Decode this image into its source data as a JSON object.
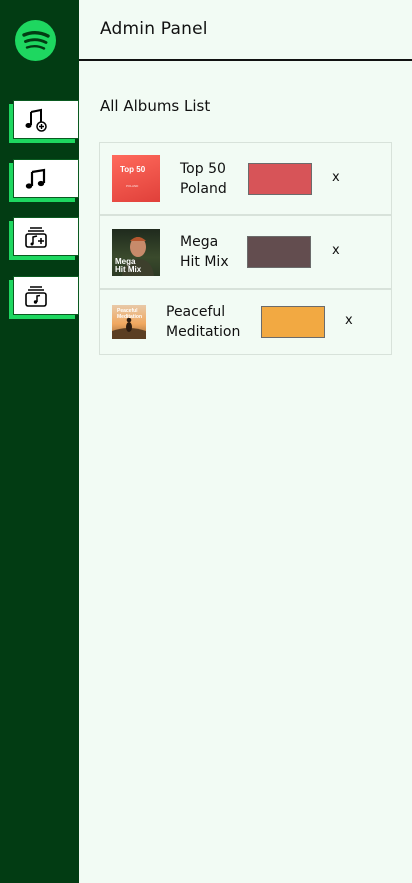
{
  "header": {
    "title": "Admin Panel"
  },
  "sidebar": {
    "logo": "spotify-logo",
    "items": [
      {
        "icon": "music-note-add-icon"
      },
      {
        "icon": "music-note-icon"
      },
      {
        "icon": "album-add-icon"
      },
      {
        "icon": "album-list-icon"
      }
    ]
  },
  "main": {
    "section_title": "All Albums List",
    "albums": [
      {
        "name": "Top 50\nPoland",
        "cover_text": "Top 50",
        "cover_sub": "POLAND",
        "color": "#d75458",
        "remove": "x"
      },
      {
        "name": "Mega\nHit Mix",
        "cover_text": "Mega\nHit Mix",
        "color": "#634d4f",
        "remove": "x"
      },
      {
        "name": "Peaceful\nMeditation",
        "cover_text": "Peaceful\nMeditation",
        "color": "#f2a942",
        "remove": "x"
      }
    ]
  },
  "colors": {
    "sidebar": "#023c13",
    "accent": "#1ed760",
    "background": "#f2fbf4"
  }
}
